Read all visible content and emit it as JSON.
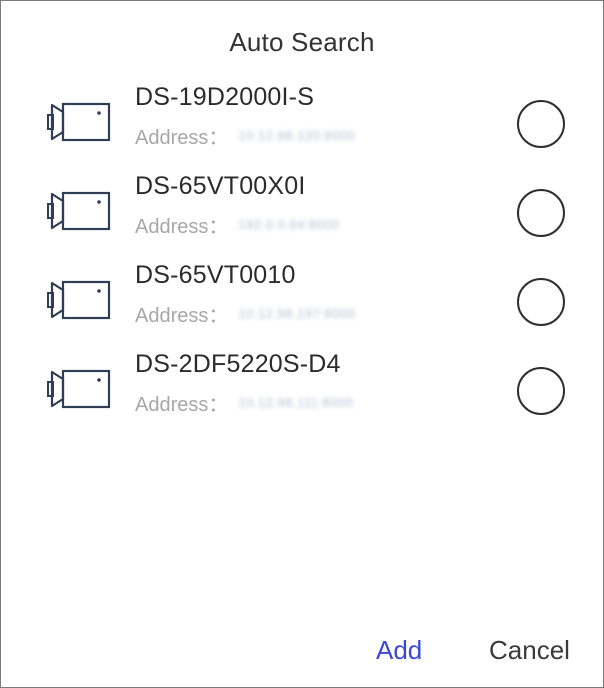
{
  "dialog": {
    "title": "Auto Search",
    "address_label": "Address：",
    "devices": [
      {
        "name": "DS-19D2000I-S",
        "address": "10.12.98.120:8000",
        "icon": "camera-icon",
        "selected": false
      },
      {
        "name": "DS-65VT00X0I",
        "address": "192.0.0.64:8000",
        "icon": "camera-icon",
        "selected": false
      },
      {
        "name": "DS-65VT0010",
        "address": "10.12.98.197:8000",
        "icon": "camera-icon",
        "selected": false
      },
      {
        "name": "DS-2DF5220S-D4",
        "address": "10.12.98.111:8000",
        "icon": "camera-icon",
        "selected": false
      }
    ],
    "add_label": "Add",
    "cancel_label": "Cancel"
  },
  "colors": {
    "accent": "#3d47d6",
    "text_primary": "#2b2b2b",
    "text_secondary": "#a7a7a7",
    "icon_stroke": "#2f3d55"
  }
}
